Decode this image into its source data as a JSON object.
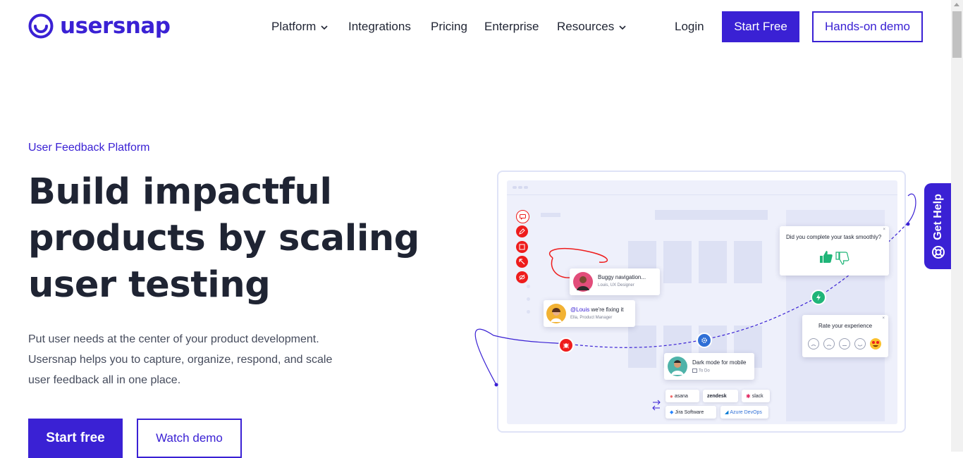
{
  "brand": {
    "name": "usersnap",
    "color": "#3a21d4"
  },
  "nav": {
    "items": [
      {
        "label": "Platform",
        "has_dropdown": true
      },
      {
        "label": "Integrations",
        "has_dropdown": false
      },
      {
        "label": "Pricing",
        "has_dropdown": false
      },
      {
        "label": "Enterprise",
        "has_dropdown": false
      },
      {
        "label": "Resources",
        "has_dropdown": true
      }
    ],
    "login": "Login",
    "start_free": "Start Free",
    "hands_on_demo": "Hands-on demo"
  },
  "hero": {
    "eyebrow": "User Feedback Platform",
    "headline_lines": [
      "Build impactful",
      "products by scaling",
      "user testing"
    ],
    "subtext_lines": [
      "Put user needs at the center of your product development.",
      "Usersnap helps you to capture, organize, respond, and scale",
      "user feedback all in one place."
    ],
    "cta_primary": "Start free",
    "cta_secondary": "Watch demo"
  },
  "illustration": {
    "comment1": {
      "title": "Buggy navigation...",
      "subtitle": "Louis, UX Designer"
    },
    "comment2": {
      "mention": "@Louis",
      "text": " we're fixing it",
      "subtitle": "Ella, Product Manager"
    },
    "task_card": {
      "title": "Dark mode for mobile",
      "status": "To Do"
    },
    "survey": {
      "question": "Did you complete your task smoothly?"
    },
    "rating": {
      "title": "Rate your experience"
    },
    "integrations": [
      "asana",
      "zendesk",
      "slack",
      "Jira Software",
      "Azure DevOps"
    ]
  },
  "get_help": {
    "label": "Get Help"
  },
  "colors": {
    "accent": "#3a21d4",
    "text": "#1f2433",
    "red": "#ee1c1c",
    "green": "#1fb578",
    "blue": "#2f6fd6"
  }
}
